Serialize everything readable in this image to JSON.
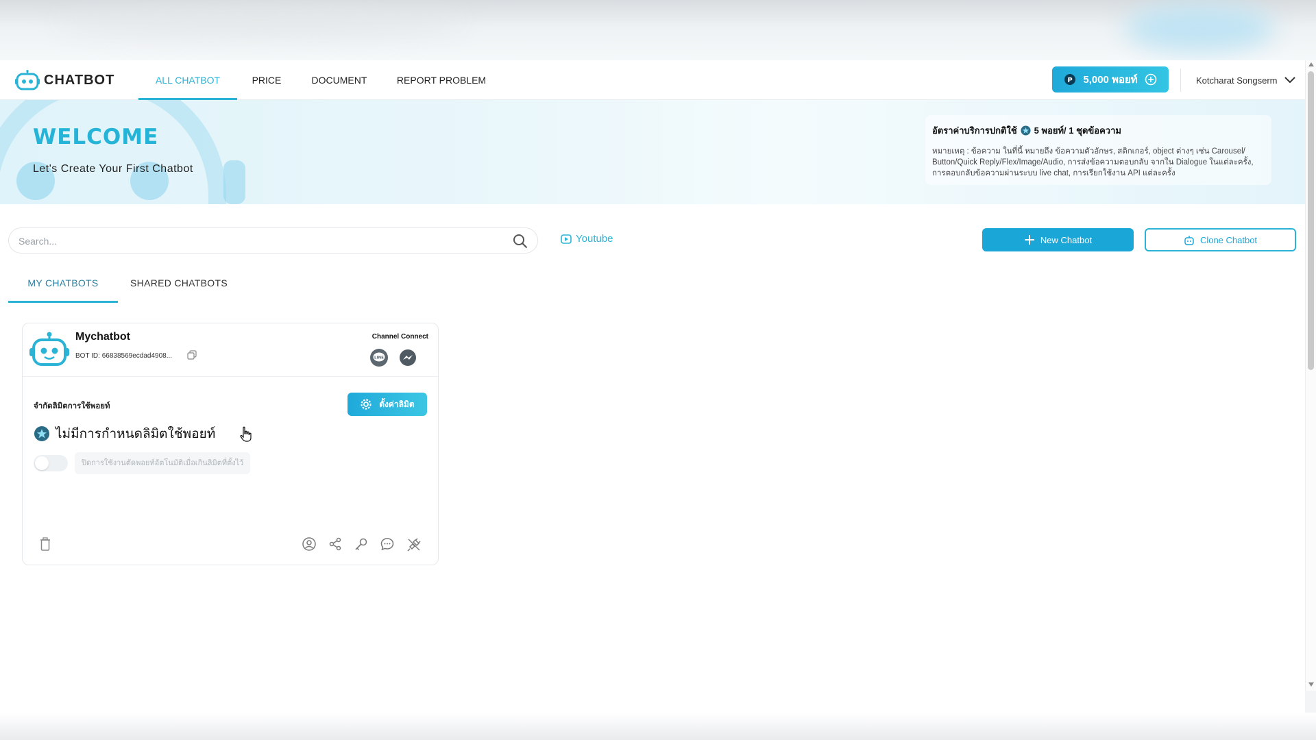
{
  "nav": {
    "logo_text": "CHATBOT",
    "tabs": [
      {
        "label": "ALL CHATBOT",
        "active": true
      },
      {
        "label": "PRICE",
        "active": false
      },
      {
        "label": "DOCUMENT",
        "active": false
      },
      {
        "label": "REPORT PROBLEM",
        "active": false
      }
    ],
    "points_label": "5,000 พอยท์",
    "user_name": "Kotcharat Songserm"
  },
  "banner": {
    "title": "WELCOME",
    "subtitle": "Let's Create Your First Chatbot",
    "rate_title_prefix": "อัตราค่าบริการปกติใช้",
    "rate_title_suffix": "5 พอยท์/ 1 ชุดข้อความ",
    "rate_note": "หมายเหตุ : ข้อความ ในที่นี้ หมายถึง ข้อความตัวอักษร, สติกเกอร์, object ต่างๆ เช่น Carousel/ Button/Quick Reply/Flex/Image/Audio, การส่งข้อความตอบกลับ จากใน Dialogue ในแต่ละครั้ง, การตอบกลับข้อความผ่านระบบ live chat, การเรียกใช้งาน API แต่ละครั้ง"
  },
  "toolbar": {
    "search_placeholder": "Search...",
    "youtube_label": "Youtube",
    "new_chatbot_label": "New Chatbot",
    "clone_chatbot_label": "Clone Chatbot"
  },
  "subtabs": [
    {
      "label": "MY CHATBOTS",
      "active": true
    },
    {
      "label": "SHARED CHATBOTS",
      "active": false
    }
  ],
  "bot_card": {
    "name": "Mychatbot",
    "bot_id": "BOT ID: 66838569ecdad4908...",
    "channel_title": "Channel Connect",
    "channels": [
      "LINE",
      "Messenger"
    ],
    "limit_label": "จำกัดลิมิตการใช้พอยท์",
    "limit_button": "ตั้งค่าลิมิต",
    "no_limit_text": "ไม่มีการกำหนดลิมิตใช้พอยท์",
    "toggle_on": false,
    "toggle_hint": "ปิดการใช้งานตัดพอยท์อัตโนมัติเมื่อเกินลิมิตที่ตั้งไว้"
  },
  "colors": {
    "accent": "#2bb3d6",
    "button": "#1ba6d8",
    "welcome": "#25b4d8"
  }
}
